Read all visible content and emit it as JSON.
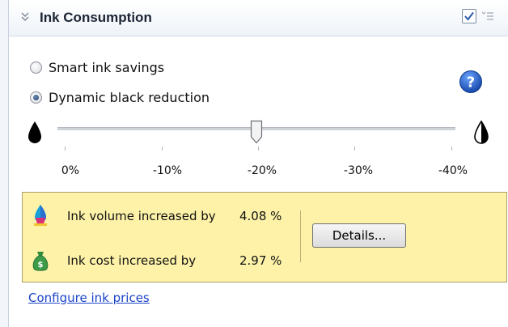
{
  "header": {
    "title": "Ink Consumption",
    "checkbox_checked": true
  },
  "options": [
    {
      "label": "Smart ink savings",
      "selected": false
    },
    {
      "label": "Dynamic black reduction",
      "selected": true
    }
  ],
  "slider": {
    "tick_labels": [
      "0%",
      "-10%",
      "-20%",
      "-30%",
      "-40%"
    ],
    "value": "-20%"
  },
  "info": {
    "volume_label": "Ink volume increased by",
    "volume_value": "4.08 %",
    "cost_label": "Ink cost increased by",
    "cost_value": "2.97 %",
    "details_button": "Details..."
  },
  "footer": {
    "link": "Configure ink prices"
  },
  "colors": {
    "info_background": "#fdf2a8",
    "link": "#1a44c8",
    "help_icon": "#1f5fbf"
  },
  "icons": [
    "collapse-chevrons-icon",
    "checkbox-check-icon",
    "menu-lines-icon",
    "help-icon",
    "ink-drop-full-icon",
    "ink-drop-half-icon",
    "ink-bottle-icon",
    "money-bag-icon"
  ]
}
